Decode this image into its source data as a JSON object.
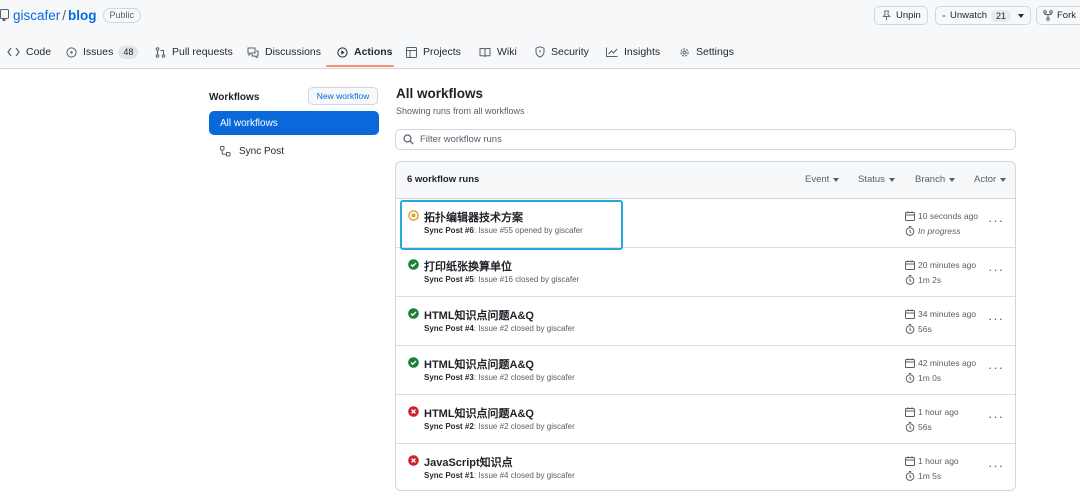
{
  "repo": {
    "owner": "giscafer",
    "separator": "/",
    "name": "blog",
    "visibility": "Public"
  },
  "header_actions": {
    "unpin_label": "Unpin",
    "unwatch_label": "Unwatch",
    "watch_count": "21",
    "fork_label": "Fork"
  },
  "tabs": [
    {
      "label": "Code",
      "icon": "code-icon"
    },
    {
      "label": "Issues",
      "count": "48",
      "icon": "issue-icon"
    },
    {
      "label": "Pull requests",
      "icon": "pull-request-icon"
    },
    {
      "label": "Discussions",
      "icon": "discussion-icon"
    },
    {
      "label": "Actions",
      "icon": "play-icon",
      "active": true
    },
    {
      "label": "Projects",
      "icon": "table-icon"
    },
    {
      "label": "Wiki",
      "icon": "book-icon"
    },
    {
      "label": "Security",
      "icon": "shield-icon"
    },
    {
      "label": "Insights",
      "icon": "graph-icon"
    },
    {
      "label": "Settings",
      "icon": "gear-icon"
    }
  ],
  "sidebar": {
    "title": "Workflows",
    "new_workflow_label": "New workflow",
    "items": [
      {
        "label": "All workflows",
        "selected": true
      },
      {
        "label": "Sync Post",
        "icon": "workflow-icon"
      }
    ]
  },
  "main": {
    "title": "All workflows",
    "subtitle": "Showing runs from all workflows",
    "filter_placeholder": "Filter workflow runs",
    "runs_count": "6 workflow runs",
    "filters": [
      "Event",
      "Status",
      "Branch",
      "Actor"
    ],
    "runs": [
      {
        "title": "拓扑编辑器技术方案",
        "workflow": "Sync Post #6",
        "meta": ": Issue #55 opened by giscafer",
        "time": "10 seconds ago",
        "duration": "In progress",
        "status": "in_progress"
      },
      {
        "title": "打印纸张换算单位",
        "workflow": "Sync Post #5",
        "meta": ": Issue #16 closed by giscafer",
        "time": "20 minutes ago",
        "duration": "1m 2s",
        "status": "success"
      },
      {
        "title": "HTML知识点问题A&Q",
        "workflow": "Sync Post #4",
        "meta": ": Issue #2 closed by giscafer",
        "time": "34 minutes ago",
        "duration": "56s",
        "status": "success"
      },
      {
        "title": "HTML知识点问题A&Q",
        "workflow": "Sync Post #3",
        "meta": ": Issue #2 closed by giscafer",
        "time": "42 minutes ago",
        "duration": "1m 0s",
        "status": "success"
      },
      {
        "title": "HTML知识点问题A&Q",
        "workflow": "Sync Post #2",
        "meta": ": Issue #2 closed by giscafer",
        "time": "1 hour ago",
        "duration": "56s",
        "status": "failure"
      },
      {
        "title": "JavaScript知识点",
        "workflow": "Sync Post #1",
        "meta": ": Issue #4 closed by giscafer",
        "time": "1 hour ago",
        "duration": "1m 5s",
        "status": "failure"
      }
    ]
  },
  "colors": {
    "accent": "#0969da",
    "success": "#1a7f37",
    "failure": "#cf222e",
    "in_progress": "#d4a72c",
    "active_tab_underline": "#fd8c73",
    "highlight_box": "#2aa7d9"
  }
}
